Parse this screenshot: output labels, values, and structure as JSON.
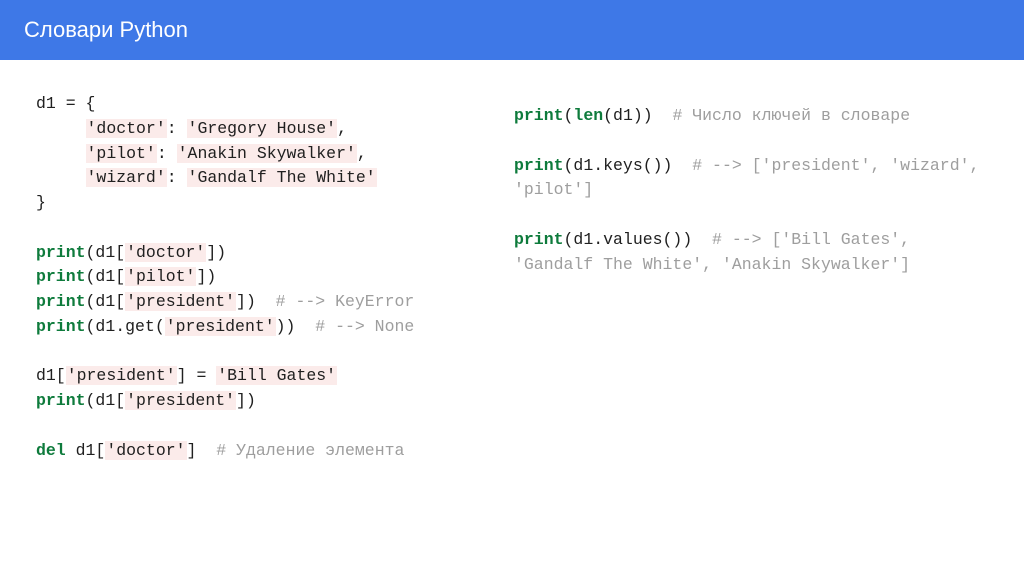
{
  "header": {
    "title": "Словари Python"
  },
  "code": {
    "left": {
      "l01_pre": "d1 = {\n     ",
      "l01_s1": "'doctor'",
      "l01_mid1": ": ",
      "l01_s2": "'Gregory House'",
      "l01_end1": ",\n     ",
      "l01_s3": "'pilot'",
      "l01_mid2": ": ",
      "l01_s4": "'Anakin Skywalker'",
      "l01_end2": ",\n     ",
      "l01_s5": "'wizard'",
      "l01_mid3": ": ",
      "l01_s6": "'Gandalf The White'",
      "l01_close": "\n}\n\n",
      "p1_kw": "print",
      "p1_open": "(d1[",
      "p1_str": "'doctor'",
      "p1_close": "])\n",
      "p2_kw": "print",
      "p2_open": "(d1[",
      "p2_str": "'pilot'",
      "p2_close": "])\n",
      "p3_kw": "print",
      "p3_open": "(d1[",
      "p3_str": "'president'",
      "p3_close": "])  ",
      "p3_cmt": "# --> KeyError",
      "p3_nl": "\n",
      "p4_kw": "print",
      "p4_open": "(d1.get(",
      "p4_str": "'president'",
      "p4_close": "))  ",
      "p4_cmt": "# --> None",
      "p4_nl": "\n\n",
      "assign_pre": "d1[",
      "assign_s1": "'president'",
      "assign_mid": "] = ",
      "assign_s2": "'Bill Gates'",
      "assign_nl": "\n",
      "p5_kw": "print",
      "p5_open": "(d1[",
      "p5_str": "'president'",
      "p5_close": "])\n\n",
      "del_kw": "del",
      "del_pre": " d1[",
      "del_str": "'doctor'",
      "del_close": "]  ",
      "del_cmt": "# Удаление элемента"
    },
    "right": {
      "r1_kw": "print",
      "r1_open": "(",
      "r1_kw2": "len",
      "r1_close": "(d1))  ",
      "r1_cmt": "# Число ключей в словаре",
      "r_gap1": "\n\n",
      "r2_kw": "print",
      "r2_body": "(d1.keys())  ",
      "r2_cmt": "# --> ['president', 'wizard', 'pilot']",
      "r_gap2": "\n\n",
      "r3_kw": "print",
      "r3_body": "(d1.values())  ",
      "r3_cmt": "# --> ['Bill Gates', 'Gandalf The White', 'Anakin Skywalker']"
    }
  }
}
